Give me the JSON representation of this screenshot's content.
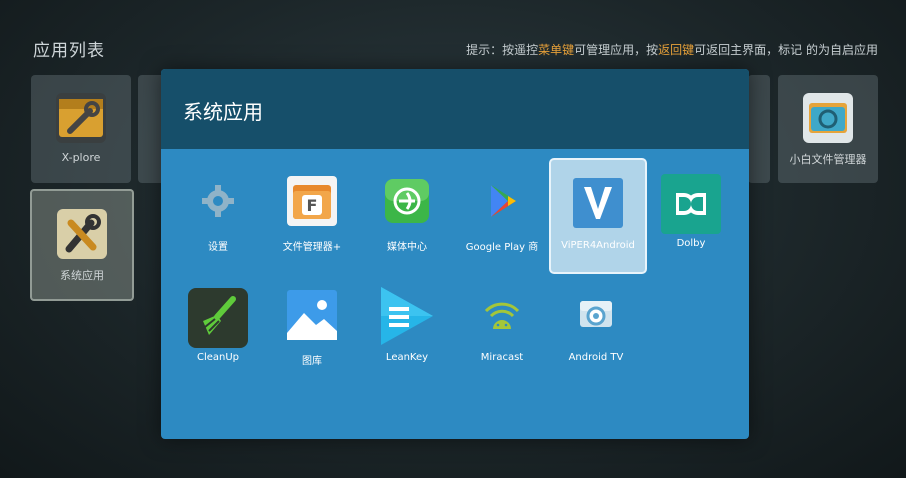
{
  "page_title": "应用列表",
  "hint": {
    "prefix": "提示：按遥控",
    "menu_key": "菜单键",
    "mid": "可管理应用，按",
    "back_key": "返回键",
    "suffix": "可返回主界面，标记   的为自启应用"
  },
  "background_tiles": [
    {
      "label": "X-plore",
      "icon": "xplore-icon"
    },
    {
      "label": "系统应用",
      "icon": "system-apps-icon"
    },
    {
      "label": "小白文件管理器",
      "icon": "xiaobai-file-manager-icon"
    }
  ],
  "dialog": {
    "title": "系统应用",
    "apps": [
      {
        "label": "设置",
        "icon": "gear-icon"
      },
      {
        "label": "文件管理器+",
        "icon": "file-manager-icon"
      },
      {
        "label": "媒体中心",
        "icon": "media-center-icon"
      },
      {
        "label": "Google Play 商",
        "icon": "google-play-icon"
      },
      {
        "label": "ViPER4Android",
        "icon": "viper-icon",
        "selected": true
      },
      {
        "label": "Dolby",
        "icon": "dolby-icon"
      },
      {
        "label": "CleanUp",
        "icon": "broom-icon"
      },
      {
        "label": "图库",
        "icon": "gallery-icon"
      },
      {
        "label": "LeanKey",
        "icon": "leankey-icon"
      },
      {
        "label": "Miracast",
        "icon": "miracast-icon"
      },
      {
        "label": "Android TV",
        "icon": "android-tv-icon"
      }
    ]
  },
  "colors": {
    "dialog_bg": "#2d8ac2",
    "dialog_header": "#164f6a",
    "hint_highlight": "#e8a23a"
  }
}
